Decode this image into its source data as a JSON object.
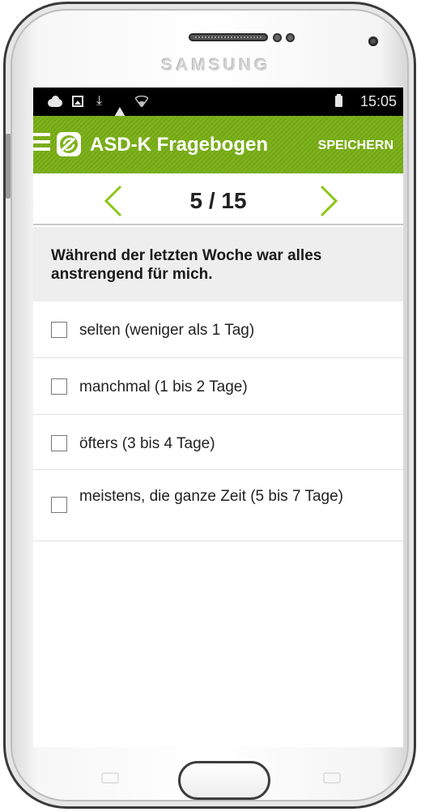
{
  "device": {
    "brand": "SAMSUNG"
  },
  "statusbar": {
    "time": "15:05",
    "icons": [
      "cloud-upload-icon",
      "image-icon",
      "download-icon",
      "warning-icon",
      "wifi-icon",
      "battery-icon"
    ]
  },
  "appbar": {
    "title": "ASD-K Fragebogen",
    "save_label": "SPEICHERN",
    "menu_icon": "hamburger-menu-icon",
    "logo_icon": "app-logo-icon"
  },
  "pager": {
    "current": "5 / 15",
    "prev_icon": "chevron-left-icon",
    "next_icon": "chevron-right-icon"
  },
  "question": {
    "text": "Während der letzten Woche war alles anstrengend für mich."
  },
  "options": [
    {
      "label": "selten (weniger als 1 Tag)",
      "checked": false
    },
    {
      "label": "manchmal (1 bis 2 Tage)",
      "checked": false
    },
    {
      "label": "öfters (3 bis 4 Tage)",
      "checked": false
    },
    {
      "label": "meistens, die ganze Zeit (5 bis 7 Tage)",
      "checked": false
    }
  ],
  "colors": {
    "accent_green": "#7fb31d",
    "chevron_green": "#8bc61a",
    "question_bg": "#eeeeee"
  }
}
